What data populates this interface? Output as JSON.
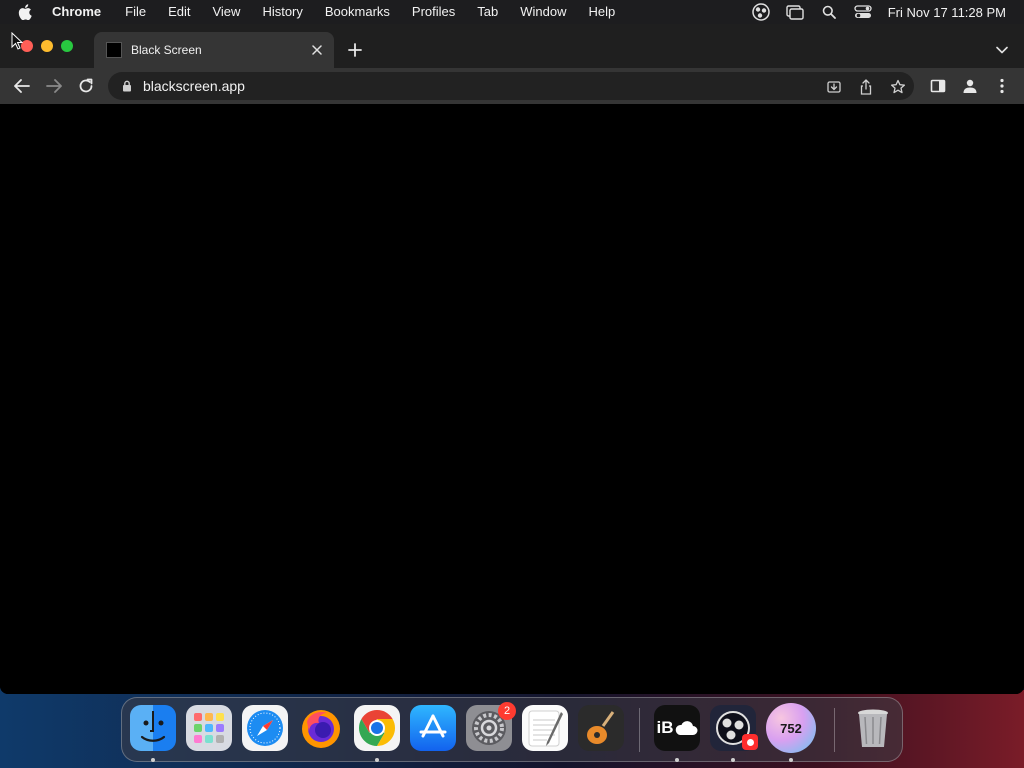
{
  "menubar": {
    "items": [
      "Chrome",
      "File",
      "Edit",
      "View",
      "History",
      "Bookmarks",
      "Profiles",
      "Tab",
      "Window",
      "Help"
    ],
    "clock": "Fri Nov 17  11:28 PM",
    "status_icons": [
      "obs-icon",
      "screen-mirroring-icon",
      "spotlight-search-icon",
      "control-center-icon"
    ]
  },
  "browser": {
    "tab": {
      "title": "Black Screen"
    },
    "address": {
      "url": "blackscreen.app"
    },
    "toolbar_icons": [
      "back-icon",
      "forward-icon",
      "reload-icon",
      "install-app-icon",
      "share-icon",
      "bookmark-star-icon",
      "side-panel-icon",
      "profile-icon",
      "menu-kebab-icon"
    ]
  },
  "dock": {
    "apps": [
      "Finder",
      "Launchpad",
      "Safari",
      "Firefox",
      "Google Chrome",
      "App Store",
      "System Settings",
      "TextEdit",
      "GarageBand",
      "iBoysoft iCloud",
      "OBS Studio",
      "752",
      "Trash"
    ],
    "settings_badge": "2",
    "counter_app_label": "752",
    "icloud_app_label": "iB"
  },
  "colors": {
    "menubar_bg": "#1d1d1f",
    "tabstrip_bg": "#1f1f1f",
    "toolbar_bg": "#353535",
    "page_bg": "#000000",
    "badge": "#ff3b30"
  }
}
